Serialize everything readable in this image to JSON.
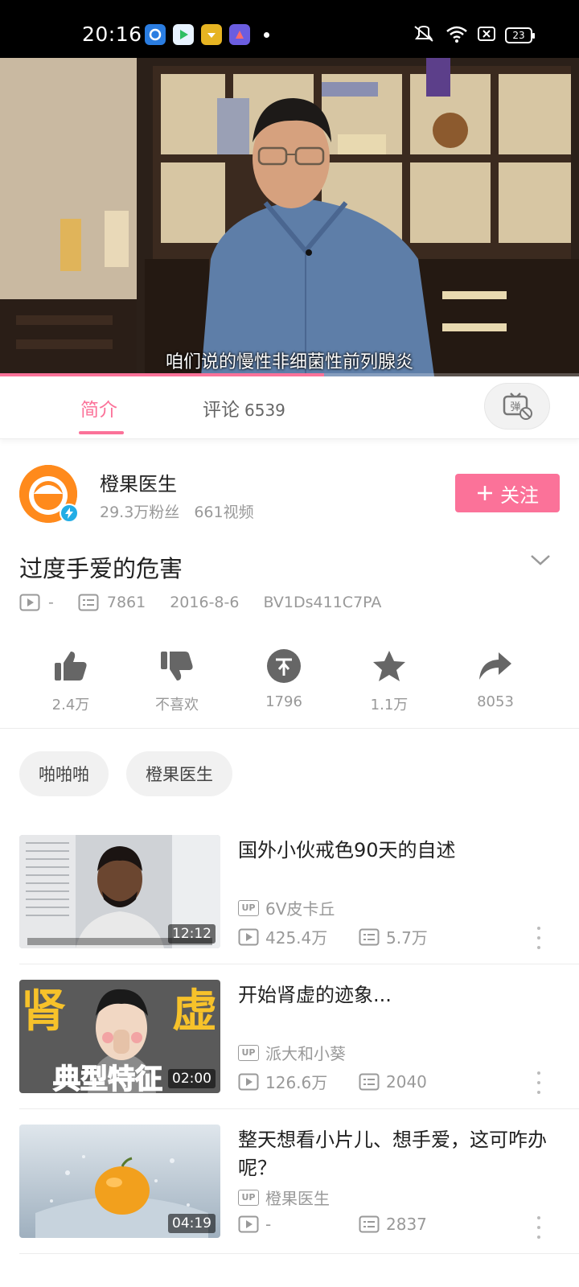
{
  "status_bar": {
    "time": "20:16",
    "battery": "23"
  },
  "video": {
    "subtitle": "咱们说的慢性非细菌性前列腺炎",
    "progress": 0.56
  },
  "tabs": {
    "intro": "简介",
    "comments_label": "评论",
    "comments_count": "6539"
  },
  "uploader": {
    "name": "橙果医生",
    "fans": "29.3万粉丝",
    "videos": "661视频",
    "follow": "关注"
  },
  "video_info": {
    "title": "过度手爱的危害",
    "views": "-",
    "danmaku": "7861",
    "date": "2016-8-6",
    "bvid": "BV1Ds411C7PA"
  },
  "actions": {
    "like": "2.4万",
    "dislike": "不喜欢",
    "coin": "1796",
    "favorite": "1.1万",
    "share": "8053"
  },
  "tags": [
    "啪啪啪",
    "橙果医生"
  ],
  "related": [
    {
      "title": "国外小伙戒色90天的自述",
      "up": "6V皮卡丘",
      "views": "425.4万",
      "danmaku": "5.7万",
      "duration": "12:12"
    },
    {
      "title": "开始肾虚的迹象...",
      "up": "派大和小葵",
      "views": "126.6万",
      "danmaku": "2040",
      "duration": "02:00"
    },
    {
      "title": "整天想看小片儿、想手爱，这可咋办呢？",
      "up": "橙果医生",
      "views": "-",
      "danmaku": "2837",
      "duration": "04:19"
    }
  ],
  "thumb_text": {
    "left": "肾",
    "right": "虚",
    "bottom": "典型特征"
  },
  "colors": {
    "accent": "#fb7299",
    "muted": "#999999"
  }
}
